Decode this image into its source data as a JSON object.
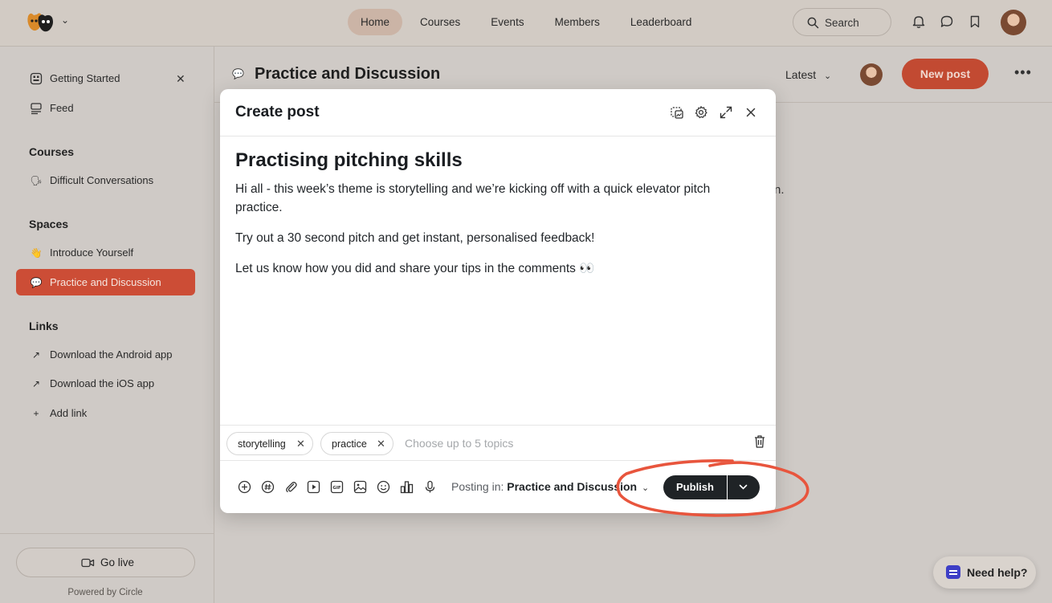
{
  "nav": {
    "items": [
      "Home",
      "Courses",
      "Events",
      "Members",
      "Leaderboard"
    ],
    "active": "Home",
    "search_placeholder": "Search"
  },
  "sidebar": {
    "top_items": [
      {
        "label": "Getting Started",
        "icon": "grid-icon"
      },
      {
        "label": "Feed",
        "icon": "feed-icon"
      }
    ],
    "sections": [
      {
        "heading": "Courses",
        "items": [
          {
            "label": "Difficult Conversations",
            "icon": "speaking-head-emoji"
          }
        ]
      },
      {
        "heading": "Spaces",
        "items": [
          {
            "label": "Introduce Yourself",
            "icon": "waving-hand-emoji"
          },
          {
            "label": "Practice and Discussion",
            "icon": "speech-bubble-emoji",
            "active": true
          }
        ]
      },
      {
        "heading": "Links",
        "items": [
          {
            "label": "Download the Android app",
            "icon": "arrow-up-right-icon"
          },
          {
            "label": "Download the iOS app",
            "icon": "arrow-up-right-icon"
          },
          {
            "label": "Add link",
            "icon": "plus-icon"
          }
        ]
      }
    ],
    "go_live": "Go live",
    "powered_by": "Powered by Circle"
  },
  "main": {
    "space_title": "Practice and Discussion",
    "sort": "Latest",
    "new_post": "New post",
    "bg_fragment": "n."
  },
  "modal": {
    "title": "Create post",
    "post_title": "Practising pitching skills",
    "paragraphs": [
      "Hi all - this week’s theme is storytelling and we’re kicking off with a quick elevator pitch practice.",
      "Try out a 30 second pitch and get instant, personalised feedback!",
      "Let us know how you did and share your tips in the comments 👀"
    ],
    "topics": [
      "storytelling",
      "practice"
    ],
    "topics_placeholder": "Choose up to 5 topics",
    "posting_in_label": "Posting in:",
    "posting_in_value": "Practice and Discussion",
    "publish": "Publish"
  },
  "help": {
    "label": "Need help?"
  },
  "colors": {
    "accent": "#c24a32",
    "active_sidebar": "#cc4d36",
    "publish": "#1f2326",
    "annotation": "#e8553d"
  }
}
